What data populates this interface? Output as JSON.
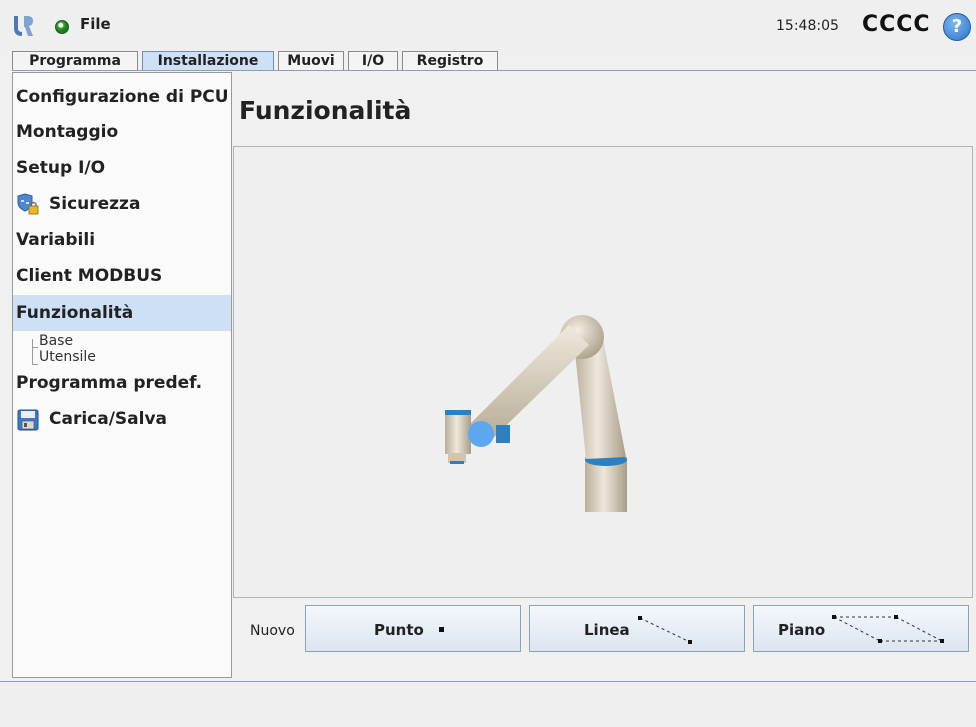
{
  "header": {
    "file_label": "File",
    "time": "15:48:05",
    "robot_name": "CCCC",
    "help_label": "?"
  },
  "tabs": [
    {
      "label": "Programma",
      "active": false
    },
    {
      "label": "Installazione",
      "active": true
    },
    {
      "label": "Muovi",
      "active": false
    },
    {
      "label": "I/O",
      "active": false
    },
    {
      "label": "Registro",
      "active": false
    }
  ],
  "sidebar": {
    "items": [
      {
        "label": "Configurazione di PCU"
      },
      {
        "label": "Montaggio"
      },
      {
        "label": "Setup I/O"
      },
      {
        "label": "Sicurezza",
        "icon": "safety-shield-lock-icon"
      },
      {
        "label": "Variabili"
      },
      {
        "label": "Client MODBUS"
      },
      {
        "label": "Funzionalità",
        "selected": true
      },
      {
        "label": "Programma predef."
      },
      {
        "label": "Carica/Salva",
        "icon": "floppy-disk-icon"
      }
    ],
    "sub_items": [
      {
        "label": "Base"
      },
      {
        "label": "Utensile"
      }
    ]
  },
  "main": {
    "title": "Funzionalità",
    "new_label": "Nuovo",
    "buttons": [
      {
        "label": "Punto",
        "icon": "point-icon"
      },
      {
        "label": "Linea",
        "icon": "line-icon"
      },
      {
        "label": "Piano",
        "icon": "plane-icon"
      }
    ]
  },
  "colors": {
    "selected_bg": "#cde0f5",
    "accent_blue": "#5da7f0",
    "robot_body": "#d9d0bd",
    "joint_ring": "#2e7fc0"
  }
}
